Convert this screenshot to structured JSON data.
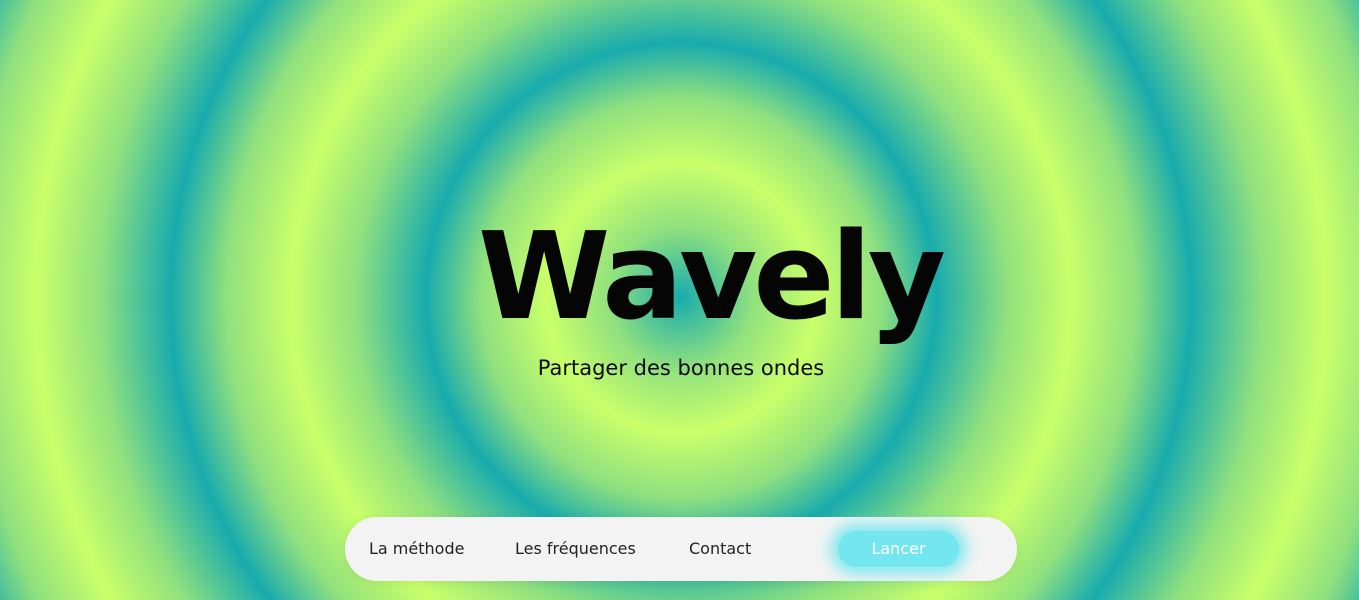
{
  "hero": {
    "logo_text": "Wavely",
    "tagline": "Partager des bonnes ondes"
  },
  "nav": {
    "links": [
      {
        "label": "La méthode"
      },
      {
        "label": "Les fréquences"
      },
      {
        "label": "Contact"
      }
    ],
    "cta_label": "Lancer"
  },
  "colors": {
    "background_teal": "#18abad",
    "background_lime": "#caff6a",
    "navbar_bg": "#f3f3f3",
    "cta_bg": "#74e6ef",
    "text_dark": "#050505"
  }
}
